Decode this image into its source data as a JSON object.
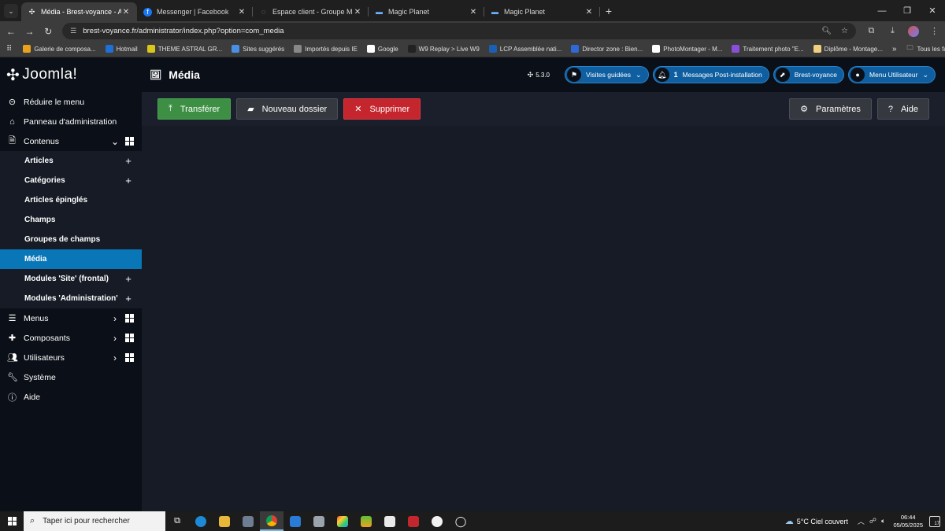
{
  "browser": {
    "tabs": [
      {
        "title": "Média - Brest-voyance - Admin",
        "active": true,
        "icon": "joomla-icon"
      },
      {
        "title": "Messenger | Facebook",
        "active": false,
        "icon": "facebook-icon"
      },
      {
        "title": "Espace client - Groupe Magic O",
        "active": false,
        "icon": "globe-icon"
      },
      {
        "title": "Magic Planet",
        "active": false,
        "icon": "magic-planet-icon"
      },
      {
        "title": "Magic Planet",
        "active": false,
        "icon": "magic-planet-icon"
      }
    ],
    "new_tab_label": "+",
    "url": "brest-voyance.fr/administrator/index.php?option=com_media",
    "bookmarks": [
      {
        "label": "Galerie de composa...",
        "color": "#e8a21e"
      },
      {
        "label": "Hotmail",
        "color": "#1e6fd6"
      },
      {
        "label": "THEME ASTRAL GR...",
        "color": "#d9c61b"
      },
      {
        "label": "Sites suggérés",
        "color": "#4a90e2"
      },
      {
        "label": "Importés depuis IE",
        "color": "#888888"
      },
      {
        "label": "Google",
        "color": "#ffffff"
      },
      {
        "label": "W9 Replay > Live W9",
        "color": "#222222"
      },
      {
        "label": "LCP Assemblée nati...",
        "color": "#1a5fb4"
      },
      {
        "label": "Director zone : Bien...",
        "color": "#2d6ad8"
      },
      {
        "label": "PhotoMontager - M...",
        "color": "#ffffff"
      },
      {
        "label": "Traitement photo \"E...",
        "color": "#8a4fd8"
      },
      {
        "label": "Diplôme - Montage...",
        "color": "#f0d080"
      }
    ],
    "bookmarks_more": "»",
    "all_bookmarks": "Tous les favoris"
  },
  "header": {
    "logo": "Joomla!",
    "page_title": "Média",
    "version": "5.3.0",
    "guided_tours": "Visites guidées",
    "notifications_count": "1",
    "post_install": "Messages Post-installation",
    "site_link": "Brest-voyance",
    "user_menu": "Menu Utilisateur"
  },
  "sidebar": {
    "toggle": "Réduire le menu",
    "dashboard": "Panneau d'administration",
    "content": "Contenus",
    "content_items": [
      {
        "label": "Articles",
        "plus": true
      },
      {
        "label": "Catégories",
        "plus": true
      },
      {
        "label": "Articles épinglés",
        "plus": false
      },
      {
        "label": "Champs",
        "plus": false
      },
      {
        "label": "Groupes de champs",
        "plus": false
      },
      {
        "label": "Média",
        "plus": false,
        "active": true
      },
      {
        "label": "Modules 'Site' (frontal)",
        "plus": true
      },
      {
        "label": "Modules 'Administration'",
        "plus": true
      }
    ],
    "menus": "Menus",
    "components": "Composants",
    "users": "Utilisateurs",
    "system": "Système",
    "help": "Aide"
  },
  "toolbar": {
    "upload": "Transférer",
    "new_folder": "Nouveau dossier",
    "delete": "Supprimer",
    "options": "Paramètres",
    "help": "Aide"
  },
  "taskbar": {
    "search_placeholder": "Taper ici pour rechercher",
    "weather": "5°C  Ciel couvert",
    "time": "06:44",
    "date": "05/05/2025",
    "notif_count": "17"
  }
}
